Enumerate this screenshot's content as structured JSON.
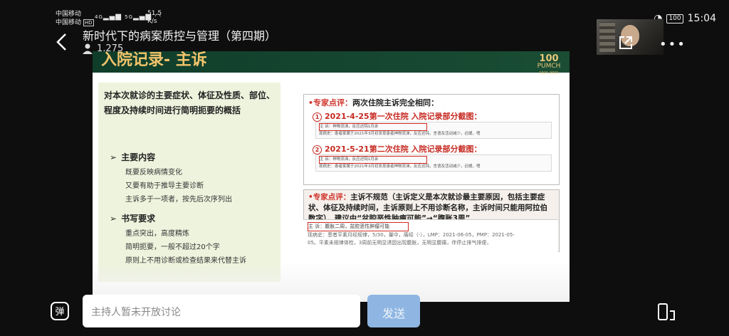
{
  "status_bar": {
    "carrier_1": "中国移动",
    "carrier_2": "中国移动",
    "net_type": "HD",
    "signal_1": "4G",
    "signal_2": "5G",
    "speed_value": "51.5",
    "speed_unit": "K/s",
    "battery": "100",
    "time": "15:04"
  },
  "header": {
    "title": "新时代下的病案质控与管理（第四期）",
    "viewer_count": "1,275"
  },
  "slide": {
    "heading": "入院记录- 主诉",
    "logo_num": "100",
    "logo_text": "PUMCH",
    "logo_year": "1921-2021",
    "definition": "对本次就诊的主要症状、体征及性质、部位、程度及持续时间进行简明扼要的概括",
    "section1": "主要内容",
    "section1_items": [
      "既要反映病情变化",
      "又要有助于推导主要诊断",
      "主诉多于一项者，按先后次序列出"
    ],
    "section2": "书写要求",
    "section2_items": [
      "重点突出，高度精炼",
      "简明扼要，一般不超过20个字",
      "原则上不用诊断或检查结果来代替主诉"
    ],
    "expert1_tag": "•专家点评：",
    "expert1_text": "两次住院主诉完全相同：",
    "case1_num": "1",
    "case1_title": "2021-4-25第一次住院 入院记录部分截图：",
    "case1_line1": "主 诉：神物流涕，反应迟钝1月余",
    "case1_line2": "现病史：患者家属于2021年3月初发现患者神物流涕，反应迟钝，言语及活动减少，迟缓，嗜",
    "case2_num": "2",
    "case2_title": "2021-5-21第二次住院 入院记录部分截图：",
    "case2_line1": "主 诉：神物流涕，反应迟钝1月余",
    "case2_line2": "现病史：患者家属于2021年3月初发现患者神物流涕，反应迟钝，言语及活动减少，迟缓，嗜",
    "expert2_tag": "•专家点评：",
    "expert2_text": "主诉不规范（主诉定义是本次就诊最主要原因，包括主要症状、体征及持续时间，主诉原则上不用诊断名称，主诉时间只能用阿拉伯数字），建议由“盆腔恶性肿瘤可能”→“腹胀3周”",
    "case3_line1": "主 诉：腹胀二周，盆腔恶性肿瘤可能",
    "case3_line2": "现病史：患者平素月经规律，5/30，量中，痛经（-），LMP：2021-06-05，PMP：2021-05-",
    "case3_line3": "05。平素未规律体检，3周前无明显诱因出现腹胀，无明显腹痛，伴停止排气排便，"
  },
  "bottom": {
    "input_placeholder": "主持人暂未开放讨论",
    "send_label": "发送",
    "danmu_label": "弹"
  }
}
